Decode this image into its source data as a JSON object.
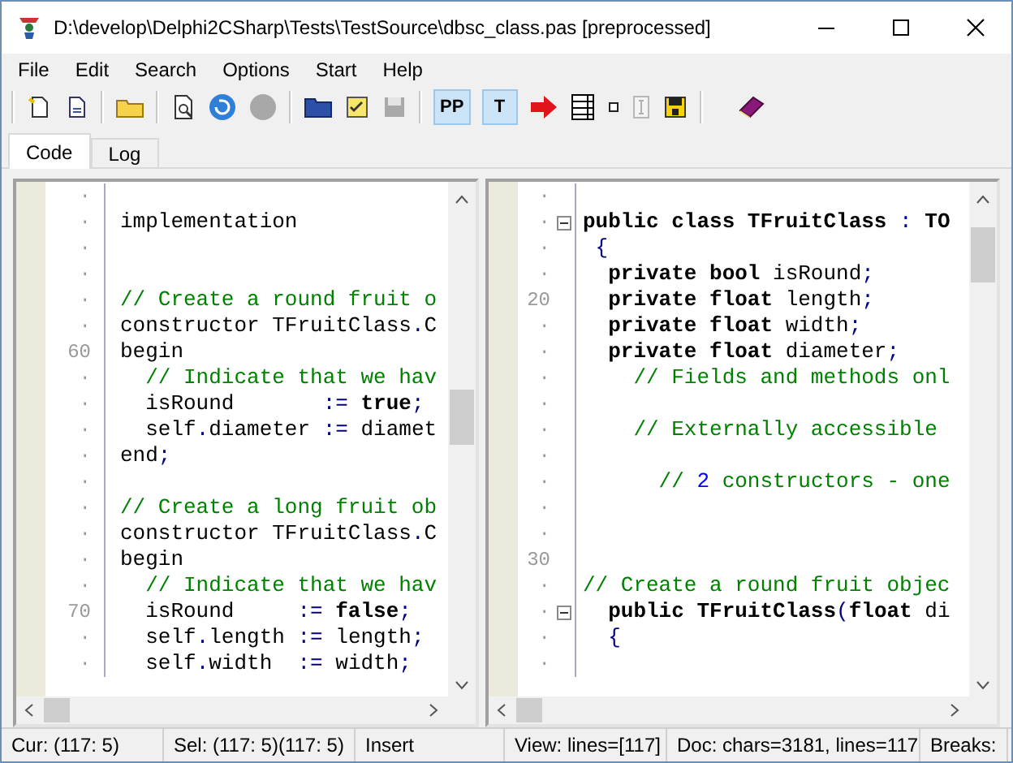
{
  "window": {
    "title": "D:\\develop\\Delphi2CSharp\\Tests\\TestSource\\dbsc_class.pas [preprocessed]"
  },
  "menu": [
    "File",
    "Edit",
    "Search",
    "Options",
    "Start",
    "Help"
  ],
  "toolbar_toggles": [
    {
      "label": "PP",
      "selected": true
    },
    {
      "label": "T",
      "selected": true
    }
  ],
  "tabs": [
    {
      "label": "Code",
      "selected": true
    },
    {
      "label": "Log",
      "selected": false
    }
  ],
  "left_pane": {
    "lines": [
      {
        "gutter": "·"
      },
      {
        "gutter": "·",
        "tokens": [
          {
            "t": "implementation",
            "kind": "id"
          }
        ]
      },
      {
        "gutter": "·"
      },
      {
        "gutter": "·"
      },
      {
        "gutter": "·",
        "tokens": [
          {
            "t": "// Create a round fruit o",
            "kind": "cmt"
          }
        ]
      },
      {
        "gutter": "·",
        "tokens": [
          {
            "t": "constructor TFruitClass",
            "kind": "id"
          },
          {
            "t": ".",
            "kind": "sym"
          },
          {
            "t": "C",
            "kind": "id"
          }
        ]
      },
      {
        "gutter": "60",
        "tokens": [
          {
            "t": "begin",
            "kind": "id"
          }
        ]
      },
      {
        "gutter": "·",
        "tokens": [
          {
            "t": "  // Indicate that we hav",
            "kind": "cmt"
          }
        ]
      },
      {
        "gutter": "·",
        "tokens": [
          {
            "t": "  isRound       ",
            "kind": "id"
          },
          {
            "t": ":=",
            "kind": "sym"
          },
          {
            "t": " true",
            "kind": "kw"
          },
          {
            "t": ";",
            "kind": "sym"
          }
        ]
      },
      {
        "gutter": "·",
        "tokens": [
          {
            "t": "  self",
            "kind": "id"
          },
          {
            "t": ".",
            "kind": "sym"
          },
          {
            "t": "diameter ",
            "kind": "id"
          },
          {
            "t": ":=",
            "kind": "sym"
          },
          {
            "t": " diamet",
            "kind": "id"
          }
        ]
      },
      {
        "gutter": "·",
        "tokens": [
          {
            "t": "end",
            "kind": "id"
          },
          {
            "t": ";",
            "kind": "sym"
          }
        ]
      },
      {
        "gutter": "·"
      },
      {
        "gutter": "·",
        "tokens": [
          {
            "t": "// Create a long fruit ob",
            "kind": "cmt"
          }
        ]
      },
      {
        "gutter": "·",
        "tokens": [
          {
            "t": "constructor TFruitClass",
            "kind": "id"
          },
          {
            "t": ".",
            "kind": "sym"
          },
          {
            "t": "C",
            "kind": "id"
          }
        ]
      },
      {
        "gutter": "·",
        "tokens": [
          {
            "t": "begin",
            "kind": "id"
          }
        ]
      },
      {
        "gutter": "·",
        "tokens": [
          {
            "t": "  // Indicate that we hav",
            "kind": "cmt"
          }
        ]
      },
      {
        "gutter": "70",
        "tokens": [
          {
            "t": "  isRound     ",
            "kind": "id"
          },
          {
            "t": ":=",
            "kind": "sym"
          },
          {
            "t": " false",
            "kind": "kw"
          },
          {
            "t": ";",
            "kind": "sym"
          }
        ]
      },
      {
        "gutter": "·",
        "tokens": [
          {
            "t": "  self",
            "kind": "id"
          },
          {
            "t": ".",
            "kind": "sym"
          },
          {
            "t": "length ",
            "kind": "id"
          },
          {
            "t": ":=",
            "kind": "sym"
          },
          {
            "t": " length",
            "kind": "id"
          },
          {
            "t": ";",
            "kind": "sym"
          }
        ]
      },
      {
        "gutter": "·",
        "tokens": [
          {
            "t": "  self",
            "kind": "id"
          },
          {
            "t": ".",
            "kind": "sym"
          },
          {
            "t": "width  ",
            "kind": "id"
          },
          {
            "t": ":=",
            "kind": "sym"
          },
          {
            "t": " width",
            "kind": "id"
          },
          {
            "t": ";",
            "kind": "sym"
          }
        ]
      }
    ]
  },
  "right_pane": {
    "lines": [
      {
        "gutter": "·",
        "fold": false
      },
      {
        "gutter": "·",
        "fold": true,
        "tokens": [
          {
            "t": "public class TFruitClass ",
            "kind": "kw"
          },
          {
            "t": ":",
            "kind": "sym"
          },
          {
            "t": " TO",
            "kind": "kw"
          }
        ]
      },
      {
        "gutter": "·",
        "fold": false,
        "tokens": [
          {
            "t": " {",
            "kind": "sym"
          }
        ]
      },
      {
        "gutter": "·",
        "fold": false,
        "tokens": [
          {
            "t": "  private bool ",
            "kind": "kw"
          },
          {
            "t": "isRound",
            "kind": "id"
          },
          {
            "t": ";",
            "kind": "sym"
          }
        ]
      },
      {
        "gutter": "20",
        "fold": false,
        "tokens": [
          {
            "t": "  private float ",
            "kind": "kw"
          },
          {
            "t": "length",
            "kind": "id"
          },
          {
            "t": ";",
            "kind": "sym"
          }
        ]
      },
      {
        "gutter": "·",
        "fold": false,
        "tokens": [
          {
            "t": "  private float ",
            "kind": "kw"
          },
          {
            "t": "width",
            "kind": "id"
          },
          {
            "t": ";",
            "kind": "sym"
          }
        ]
      },
      {
        "gutter": "·",
        "fold": false,
        "tokens": [
          {
            "t": "  private float ",
            "kind": "kw"
          },
          {
            "t": "diameter",
            "kind": "id"
          },
          {
            "t": ";",
            "kind": "sym"
          }
        ]
      },
      {
        "gutter": "·",
        "fold": false,
        "tokens": [
          {
            "t": "    // Fields and methods onl",
            "kind": "cmt"
          }
        ]
      },
      {
        "gutter": "·",
        "fold": false
      },
      {
        "gutter": "·",
        "fold": false,
        "tokens": [
          {
            "t": "    // Externally accessible",
            "kind": "cmt"
          }
        ]
      },
      {
        "gutter": "·",
        "fold": false
      },
      {
        "gutter": "·",
        "fold": false,
        "tokens": [
          {
            "t": "      // ",
            "kind": "cmt"
          },
          {
            "t": "2",
            "kind": "num"
          },
          {
            "t": " constructors - one",
            "kind": "cmt"
          }
        ]
      },
      {
        "gutter": "·",
        "fold": false
      },
      {
        "gutter": "·",
        "fold": false
      },
      {
        "gutter": "30",
        "fold": false
      },
      {
        "gutter": "·",
        "fold": false,
        "tokens": [
          {
            "t": "// Create a round fruit objec",
            "kind": "cmt"
          }
        ]
      },
      {
        "gutter": "·",
        "fold": true,
        "tokens": [
          {
            "t": "  public TFruitClass",
            "kind": "kw"
          },
          {
            "t": "(",
            "kind": "sym"
          },
          {
            "t": "float",
            "kind": "kw"
          },
          {
            "t": " di",
            "kind": "id"
          }
        ]
      },
      {
        "gutter": "·",
        "fold": false,
        "tokens": [
          {
            "t": "  {",
            "kind": "sym"
          }
        ]
      },
      {
        "gutter": "·",
        "fold": false
      }
    ]
  },
  "status_bar": [
    "Cur: (117: 5)",
    "Sel: (117: 5)(117: 5)",
    "Insert",
    "View: lines=[117]",
    "Doc: chars=3181, lines=117",
    "Breaks:"
  ]
}
